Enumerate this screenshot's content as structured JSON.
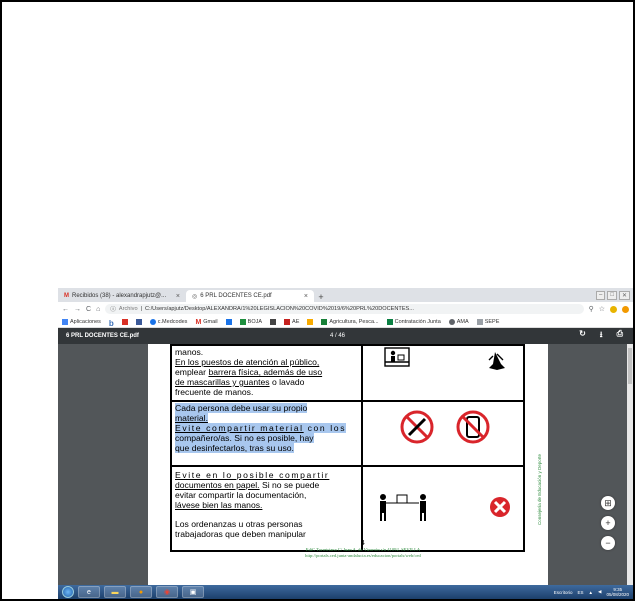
{
  "browser": {
    "tabs": [
      {
        "label": "Recibidos (38) - alexandrapjutz@...",
        "icon": "gmail-icon",
        "active": false
      },
      {
        "label": "6 PRL DOCENTES CE.pdf",
        "icon": "pdf-tab-icon",
        "active": true
      }
    ],
    "new_tab": "+",
    "window_controls": [
      "–",
      "□",
      "✕"
    ],
    "url_prefix": "Archivo",
    "url": "C:/Users/apjutz/Desktop/ALEXANDRA/1%20LEGISLACION%20COVID%2019/6%20PRL%20DOCENTES...",
    "bookmarks": [
      {
        "label": "Aplicaciones",
        "icon": "apps-icon"
      },
      {
        "label": "",
        "icon": "b-icon"
      },
      {
        "label": "",
        "icon": "grid-icon"
      },
      {
        "label": "",
        "icon": "facebook-icon"
      },
      {
        "label": "c.Medcodes",
        "icon": "medcodes-icon"
      },
      {
        "label": "Gmail",
        "icon": "gmail-icon"
      },
      {
        "label": "",
        "icon": "calendar-icon"
      },
      {
        "label": "BOJA",
        "icon": "boja-icon"
      },
      {
        "label": "",
        "icon": "boe-icon"
      },
      {
        "label": "AE",
        "icon": "ae-icon"
      },
      {
        "label": "",
        "icon": "folder-icon"
      },
      {
        "label": "Agricultura, Pesca...",
        "icon": "agricultura-icon"
      },
      {
        "label": "Contratación Junta",
        "icon": "junta-icon"
      },
      {
        "label": "AMA",
        "icon": "ama-icon"
      },
      {
        "label": "SEPE",
        "icon": "sepe-icon"
      }
    ]
  },
  "pdf": {
    "filename": "6 PRL DOCENTES CE.pdf",
    "page_indicator": "4 / 46",
    "page_number": "4",
    "footer_line1": "EdiC Torretriana C/ Juan A. de Vizarrón s/n 41092, SEVILLA",
    "footer_line2": "http://portals.ced.junta-andalucia.es/educacion/portals/web/ced",
    "side_text": "Consejería de Educación y Deporte",
    "rows": [
      {
        "p1": "manos.",
        "p2a": "En los puestos de atención al público,",
        "p2b_pre": "emplear ",
        "p2b_u": "barrera física, además de uso",
        "p2c_u": "de mascarillas y guantes",
        "p2c_post": " o lavado",
        "p2d": "frecuente de manos."
      },
      {
        "l1": "Cada persona debe usar su propio",
        "l2": "material.",
        "l3": "Evite compartir material",
        "l3b": " con los",
        "l4": "compañero/as. Si no es posible, hay",
        "l5": "que desinfectarlos, tras su uso."
      },
      {
        "l1": "Evite en lo posible compartir",
        "l2u": "documentos en papel.",
        "l2": " Si no se puede",
        "l3": "evitar compartir la documentación,",
        "l4u": "lávese bien las manos.",
        "l5": "Los ordenanzas u otras personas",
        "l6": "trabajadoras que deben manipular"
      }
    ]
  },
  "zoom": {
    "fit": "⊞",
    "in": "+",
    "out": "−"
  },
  "taskbar": {
    "lang": "ES",
    "time": "9:35",
    "date": "05/08/2020",
    "tray_label": "Escritorio"
  },
  "colors": {
    "highlight": "#a8c7ee",
    "prohibition": "#d9252b",
    "footer_green": "#2e8b3e",
    "pdf_toolbar": "#323639"
  }
}
